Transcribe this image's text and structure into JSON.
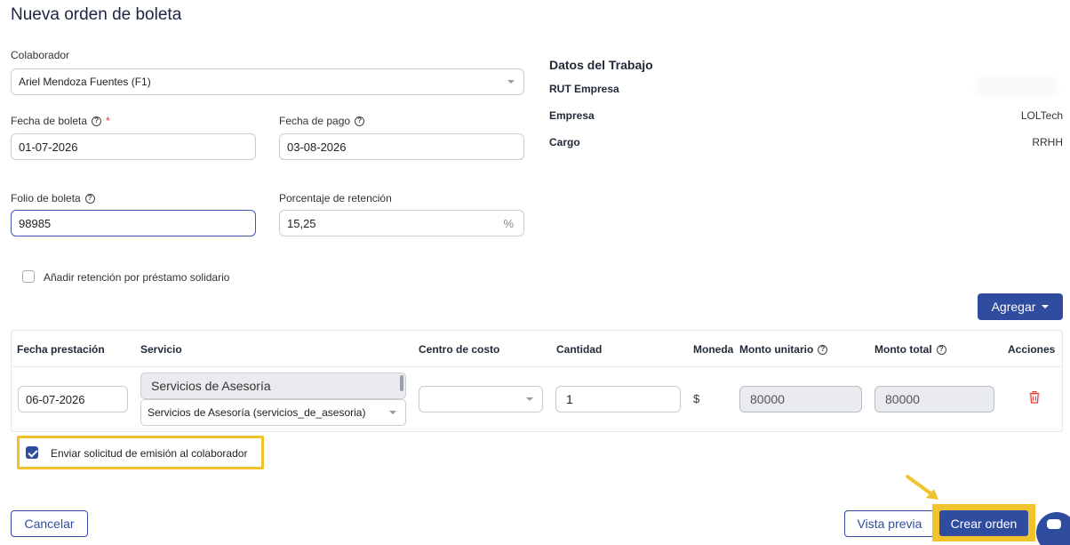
{
  "page": {
    "title": "Nueva orden de boleta"
  },
  "form": {
    "colaborador": {
      "label": "Colaborador",
      "value": "Ariel Mendoza Fuentes (F1)"
    },
    "fecha_boleta": {
      "label": "Fecha de boleta",
      "required_mark": "*",
      "value": "01-07-2026"
    },
    "fecha_pago": {
      "label": "Fecha de pago",
      "value": "03-08-2026"
    },
    "folio": {
      "label": "Folio de boleta",
      "value": "98985"
    },
    "retencion": {
      "label": "Porcentaje de retención",
      "value": "15,25",
      "suffix": "%"
    },
    "prestamo_solidario": {
      "label": "Añadir retención por préstamo solidario",
      "checked": false
    }
  },
  "help_icon_glyph": "?",
  "datos": {
    "title": "Datos del Trabajo",
    "rut_label": "RUT Empresa",
    "empresa_label": "Empresa",
    "empresa_value": "LOLTech",
    "cargo_label": "Cargo",
    "cargo_value": "RRHH"
  },
  "add_button": {
    "label": "Agregar"
  },
  "table": {
    "headers": {
      "fecha": "Fecha prestación",
      "servicio": "Servicio",
      "centro": "Centro de costo",
      "cantidad": "Cantidad",
      "moneda": "Moneda",
      "monto_unitario": "Monto unitario",
      "monto_total": "Monto total",
      "acciones": "Acciones"
    },
    "row": {
      "fecha": "06-07-2026",
      "servicio_tag": "Servicios de Asesoría",
      "servicio_select": "Servicios de Asesoría (servicios_de_asesoria)",
      "centro": "",
      "cantidad": "1",
      "moneda": "$",
      "monto_unitario": "80000",
      "monto_total": "80000"
    }
  },
  "send_request": {
    "label": "Enviar solicitud de emisión al colaborador",
    "checked": true
  },
  "footer": {
    "cancel": "Cancelar",
    "preview": "Vista previa",
    "create": "Crear orden"
  },
  "colors": {
    "primary": "#2f4c9e",
    "highlight": "#f0c22b",
    "danger": "#e53935"
  },
  "icons": [
    "help-icon",
    "chevron-down-icon",
    "trash-icon",
    "checkbox-icon",
    "arrow-icon",
    "chat-icon"
  ]
}
